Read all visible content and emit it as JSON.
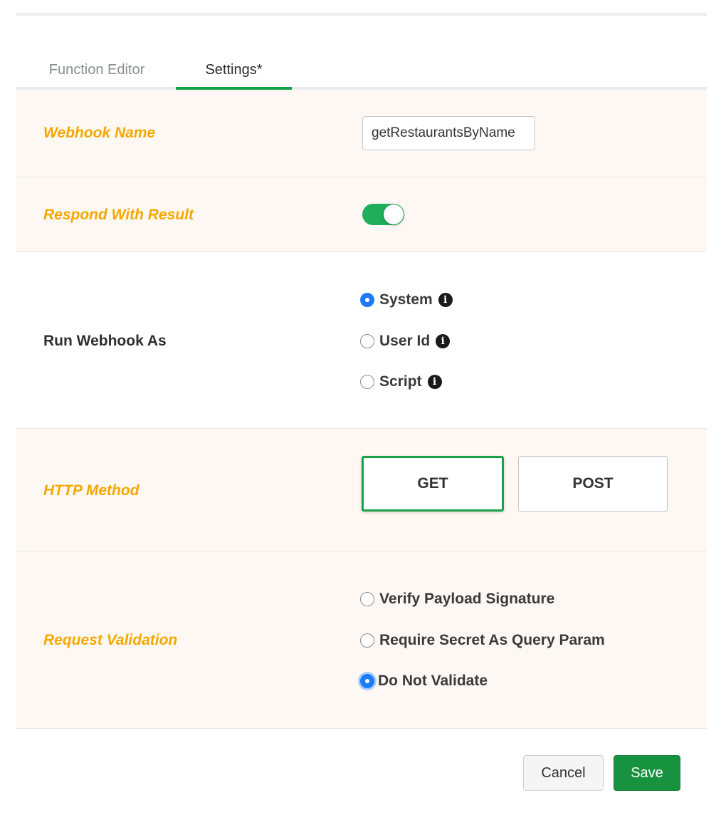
{
  "tabs": [
    {
      "label": "Function Editor",
      "active": false
    },
    {
      "label": "Settings*",
      "active": true
    }
  ],
  "webhook_name": {
    "label": "Webhook Name",
    "value": "getRestaurantsByName"
  },
  "respond_with_result": {
    "label": "Respond With Result",
    "enabled": true
  },
  "run_as": {
    "label": "Run Webhook As",
    "options": [
      {
        "label": "System",
        "checked": true,
        "info_icon": "info-icon"
      },
      {
        "label": "User Id",
        "checked": false,
        "info_icon": "info-icon"
      },
      {
        "label": "Script",
        "checked": false,
        "info_icon": "info-icon"
      }
    ],
    "info_glyph": "i"
  },
  "http_method": {
    "label": "HTTP Method",
    "options": [
      "GET",
      "POST"
    ],
    "selected": "GET"
  },
  "request_validation": {
    "label": "Request Validation",
    "options": [
      {
        "label": "Verify Payload Signature",
        "checked": false
      },
      {
        "label": "Require Secret As Query Param",
        "checked": false
      },
      {
        "label": "Do Not Validate",
        "checked": true
      }
    ]
  },
  "actions": {
    "cancel_label": "Cancel",
    "save_label": "Save"
  },
  "colors": {
    "accent_green": "#14a049",
    "label_orange": "#f5a800",
    "radio_blue": "#1e7bf5",
    "row_tint": "#fdf8f3"
  }
}
